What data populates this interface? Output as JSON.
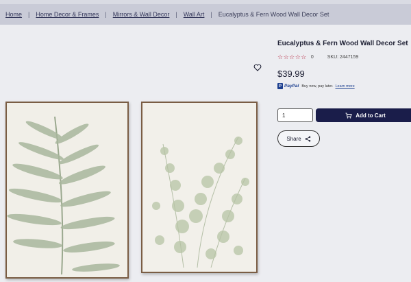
{
  "breadcrumb": {
    "items": [
      "Home",
      "Home Decor & Frames",
      "Mirrors & Wall Decor",
      "Wall Art"
    ],
    "separator": "|",
    "current": "Eucalyptus & Fern Wood Wall Decor Set"
  },
  "product": {
    "title": "Eucalyptus & Fern Wood Wall Decor Set",
    "stars": "☆☆☆☆☆",
    "rating": "0",
    "sku": "SKU: 2447159",
    "price": "$39.99",
    "paypal": {
      "icon": "P",
      "brand": "PayPal",
      "message": "Buy now, pay later.",
      "link": "Learn more"
    }
  },
  "purchase": {
    "quantity": "1",
    "add_to_cart_label": "Add to Cart",
    "share_label": "Share"
  },
  "icons": {
    "wishlist": "heart-icon",
    "cart": "cart-icon",
    "share": "share-icon"
  },
  "colors": {
    "accent": "#1a1d4a",
    "stars": "#b5233d",
    "paypal": "#1b3e8f",
    "breadcrumb_bg": "#c9cbd7"
  }
}
